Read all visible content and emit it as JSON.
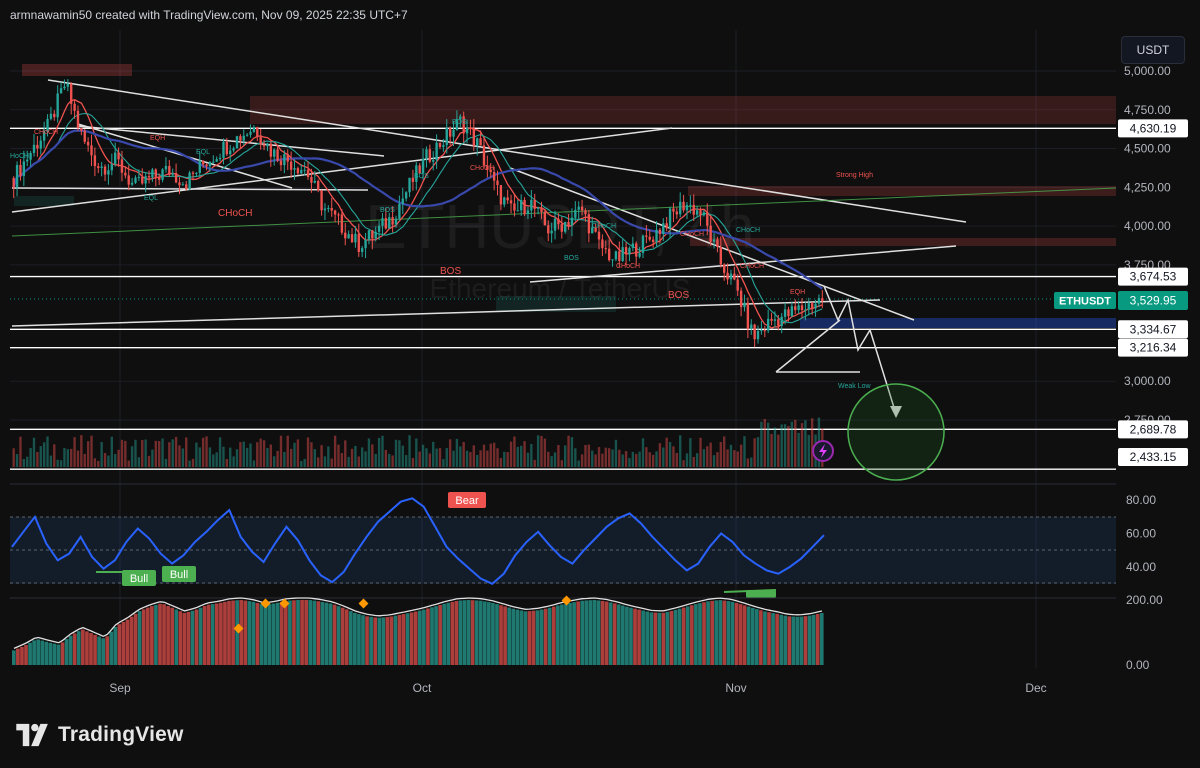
{
  "header": {
    "attribution": "armnawamin50 created with TradingView.com, Nov 09, 2025 22:35 UTC+7",
    "currency_button": "USDT"
  },
  "watermark": {
    "symbol": "ETHUSDT, 4h",
    "name": "Ethereum / TetherUS"
  },
  "brand": {
    "name": "TradingView",
    "color": "#e6e6e6"
  },
  "colors": {
    "bull": "#26a69a",
    "bear": "#ef5350",
    "rsi": "#2962ff",
    "background": "#0f0f0f",
    "price_tag": "#089981"
  },
  "chart_data": [
    {
      "type": "line",
      "title": "ETHUSDT, 4h",
      "subtitle": "Ethereum / TetherUS",
      "ylim": [
        2500,
        5150
      ],
      "y_ticks": [
        {
          "label": "5,000.00",
          "value": 5000
        },
        {
          "label": "4,750.00",
          "value": 4750
        },
        {
          "label": "4,500.00",
          "value": 4500
        },
        {
          "label": "4,250.00",
          "value": 4250
        },
        {
          "label": "4,000.00",
          "value": 4000
        },
        {
          "label": "3,750.00",
          "value": 3750
        },
        {
          "label": "3,000.00",
          "value": 3000
        },
        {
          "label": "2,750.00",
          "value": 2750
        }
      ],
      "x_ticks": [
        "Sep",
        "Oct",
        "Nov",
        "Dec"
      ],
      "last_price": {
        "symbol": "ETHUSDT",
        "label": "3,529.95",
        "value": 3529.95
      },
      "price_levels": [
        {
          "label": "4,630.19",
          "value": 4630.19
        },
        {
          "label": "3,674.53",
          "value": 3674.53
        },
        {
          "label": "3,334.67",
          "value": 3334.67
        },
        {
          "label": "3,216.34",
          "value": 3216.34
        },
        {
          "label": "2,689.78",
          "value": 2689.78
        },
        {
          "label": "2,433.15",
          "value": 2433.15
        }
      ],
      "series": [
        {
          "values": [
            4310,
            4480,
            4640,
            4920,
            4560,
            4380,
            4420,
            4250,
            4310,
            4360,
            4280,
            4400,
            4490,
            4570,
            4640,
            4480,
            4420,
            4360,
            4120,
            4010,
            3880,
            3950,
            4060,
            4260,
            4440,
            4560,
            4680,
            4520,
            4240,
            4080,
            4160,
            3980,
            4020,
            4110,
            3880,
            3780,
            3850,
            3920,
            4040,
            4150,
            4080,
            3780,
            3600,
            3280,
            3390,
            3430,
            3480,
            3529.95
          ]
        }
      ],
      "annotations": [
        "CHoCH",
        "BOS",
        "EQH",
        "EQL",
        "Strong High",
        "Weak Low",
        "HoCH"
      ]
    },
    {
      "type": "line",
      "title": "RSI",
      "ylim": [
        20,
        90
      ],
      "y_ticks": [
        {
          "label": "80.00",
          "value": 80
        },
        {
          "label": "60.00",
          "value": 60
        },
        {
          "label": "40.00",
          "value": 40
        }
      ],
      "band": [
        30,
        70
      ],
      "series": [
        {
          "values": [
            52,
            61,
            70,
            54,
            44,
            48,
            58,
            46,
            39,
            44,
            55,
            63,
            57,
            48,
            42,
            47,
            55,
            61,
            68,
            74,
            58,
            49,
            43,
            54,
            64,
            56,
            44,
            35,
            31,
            37,
            48,
            58,
            67,
            73,
            79,
            81,
            76,
            64,
            52,
            45,
            39,
            33,
            30,
            36,
            47,
            55,
            61,
            53,
            46,
            42,
            50,
            57,
            64,
            69,
            72,
            66,
            58,
            51,
            44,
            38,
            42,
            52,
            60,
            55,
            47,
            42,
            38,
            36,
            40,
            45,
            52,
            59
          ]
        }
      ],
      "labels": [
        "Bull",
        "Bull",
        "Bear",
        "Bull"
      ]
    },
    {
      "type": "area",
      "ylim": [
        0,
        200
      ],
      "y_ticks": [
        {
          "label": "200.00",
          "value": 200
        },
        {
          "label": "0.00",
          "value": 0
        }
      ],
      "series": [
        {
          "values": [
            45,
            60,
            80,
            70,
            62,
            90,
            110,
            95,
            80,
            120,
            140,
            165,
            180,
            190,
            175,
            160,
            170,
            185,
            190,
            198,
            200,
            195,
            185,
            190,
            198,
            200,
            200,
            195,
            188,
            175,
            160,
            150,
            145,
            148,
            155,
            162,
            170,
            180,
            190,
            198,
            200,
            198,
            192,
            182,
            172,
            165,
            168,
            175,
            185,
            192,
            198,
            200,
            196,
            188,
            178,
            170,
            162,
            160,
            168,
            178,
            188,
            196,
            200,
            196,
            186,
            175,
            165,
            158,
            150,
            148,
            152,
            160
          ]
        }
      ]
    }
  ]
}
